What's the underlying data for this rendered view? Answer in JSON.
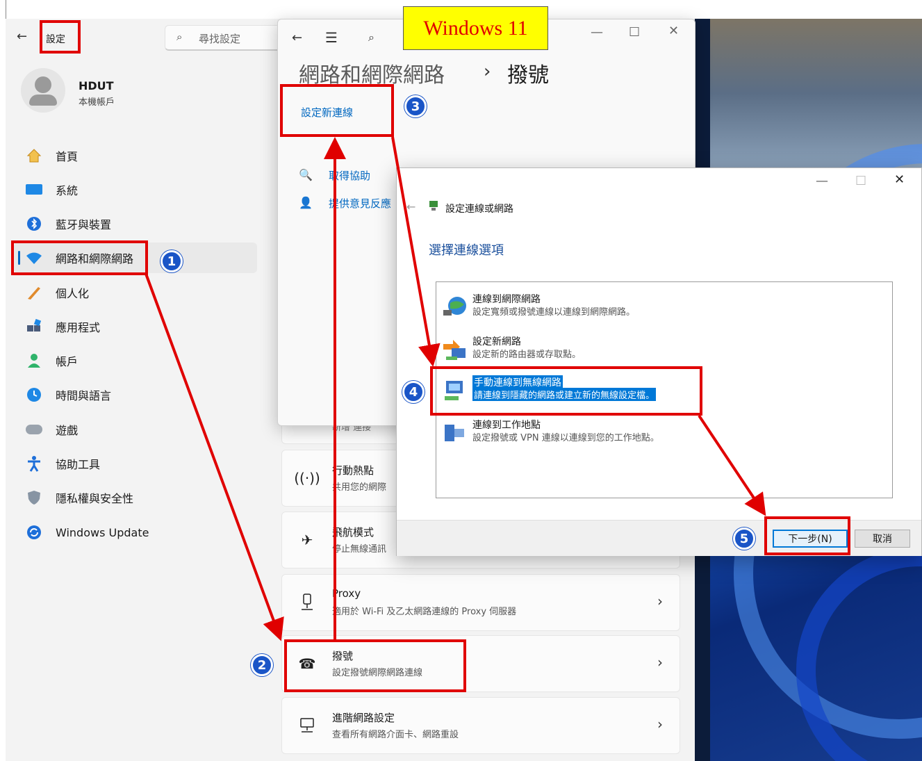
{
  "annotation": {
    "title": "Windows 11",
    "steps": [
      "1",
      "2",
      "3",
      "4",
      "5"
    ]
  },
  "settings": {
    "title": "設定",
    "search_placeholder": "尋找設定",
    "user": {
      "name": "HDUT",
      "type": "本機帳戶"
    },
    "nav": [
      {
        "label": "首頁",
        "icon": "home-icon"
      },
      {
        "label": "系統",
        "icon": "system-icon"
      },
      {
        "label": "藍牙與裝置",
        "icon": "bluetooth-icon"
      },
      {
        "label": "網路和網際網路",
        "icon": "wifi-icon"
      },
      {
        "label": "個人化",
        "icon": "brush-icon"
      },
      {
        "label": "應用程式",
        "icon": "apps-icon"
      },
      {
        "label": "帳戶",
        "icon": "account-icon"
      },
      {
        "label": "時間與語言",
        "icon": "clock-globe-icon"
      },
      {
        "label": "遊戲",
        "icon": "gamepad-icon"
      },
      {
        "label": "協助工具",
        "icon": "accessibility-icon"
      },
      {
        "label": "隱私權與安全性",
        "icon": "shield-icon"
      },
      {
        "label": "Windows Update",
        "icon": "update-icon"
      }
    ],
    "cards": [
      {
        "title": "行動熱點",
        "desc": "共用您的網際",
        "icon": "hotspot-icon"
      },
      {
        "title": "飛航模式",
        "desc": "停止無線通訊",
        "icon": "airplane-icon"
      },
      {
        "title": "Proxy",
        "desc": "適用於 Wi-Fi 及乙太網路連線的 Proxy 伺服器",
        "icon": "proxy-icon"
      },
      {
        "title": "撥號",
        "desc": "設定撥號網際網路連線",
        "icon": "dialup-icon"
      },
      {
        "title": "進階網路設定",
        "desc": "查看所有網路介面卡、網路重設",
        "icon": "advanced-network-icon"
      }
    ],
    "partial_text": "新增    連接"
  },
  "dialup_window": {
    "breadcrumb_parent": "網路和網際網路",
    "breadcrumb_sep": "›",
    "breadcrumb_current": "撥號",
    "setup_link": "設定新連線",
    "get_help": "取得協助",
    "feedback": "提供意見反應"
  },
  "connection_dialog": {
    "title": "設定連線或網路",
    "heading": "選擇連線選項",
    "options": [
      {
        "title": "連線到網際網路",
        "desc": "設定寬頻或撥號連線以連線到網際網路。",
        "icon": "globe-network-icon"
      },
      {
        "title": "設定新網路",
        "desc": "設定新的路由器或存取點。",
        "icon": "router-icon"
      },
      {
        "title": "手動連線到無線網路",
        "desc": "請連線到隱藏的網路或建立新的無線設定檔。",
        "icon": "wireless-icon",
        "selected": true
      },
      {
        "title": "連線到工作地點",
        "desc": "設定撥號或 VPN 連線以連線到您的工作地點。",
        "icon": "workplace-icon"
      }
    ],
    "next_button": "下一步(N)",
    "cancel_button": "取消"
  }
}
